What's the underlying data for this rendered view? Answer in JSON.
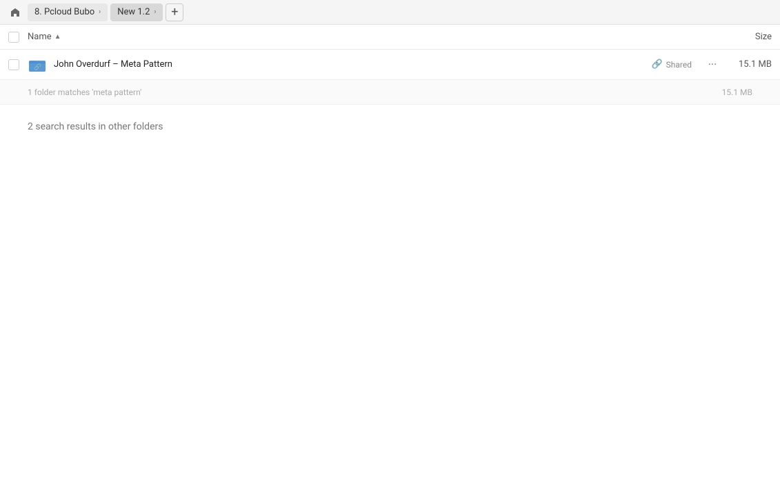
{
  "breadcrumb": {
    "home_icon": "⌂",
    "items": [
      {
        "label": "8. Pcloud Bubo",
        "active": false
      },
      {
        "label": "New 1.2",
        "active": true
      }
    ],
    "add_icon": "+"
  },
  "column_header": {
    "name_label": "Name",
    "sort_arrow": "▲",
    "size_label": "Size"
  },
  "file_row": {
    "name": "John Overdurf – Meta Pattern",
    "shared_label": "Shared",
    "size": "15.1 MB"
  },
  "summary": {
    "text": "1 folder matches 'meta pattern'",
    "size": "15.1 MB"
  },
  "other_folders": {
    "text": "2 search results in other folders"
  }
}
